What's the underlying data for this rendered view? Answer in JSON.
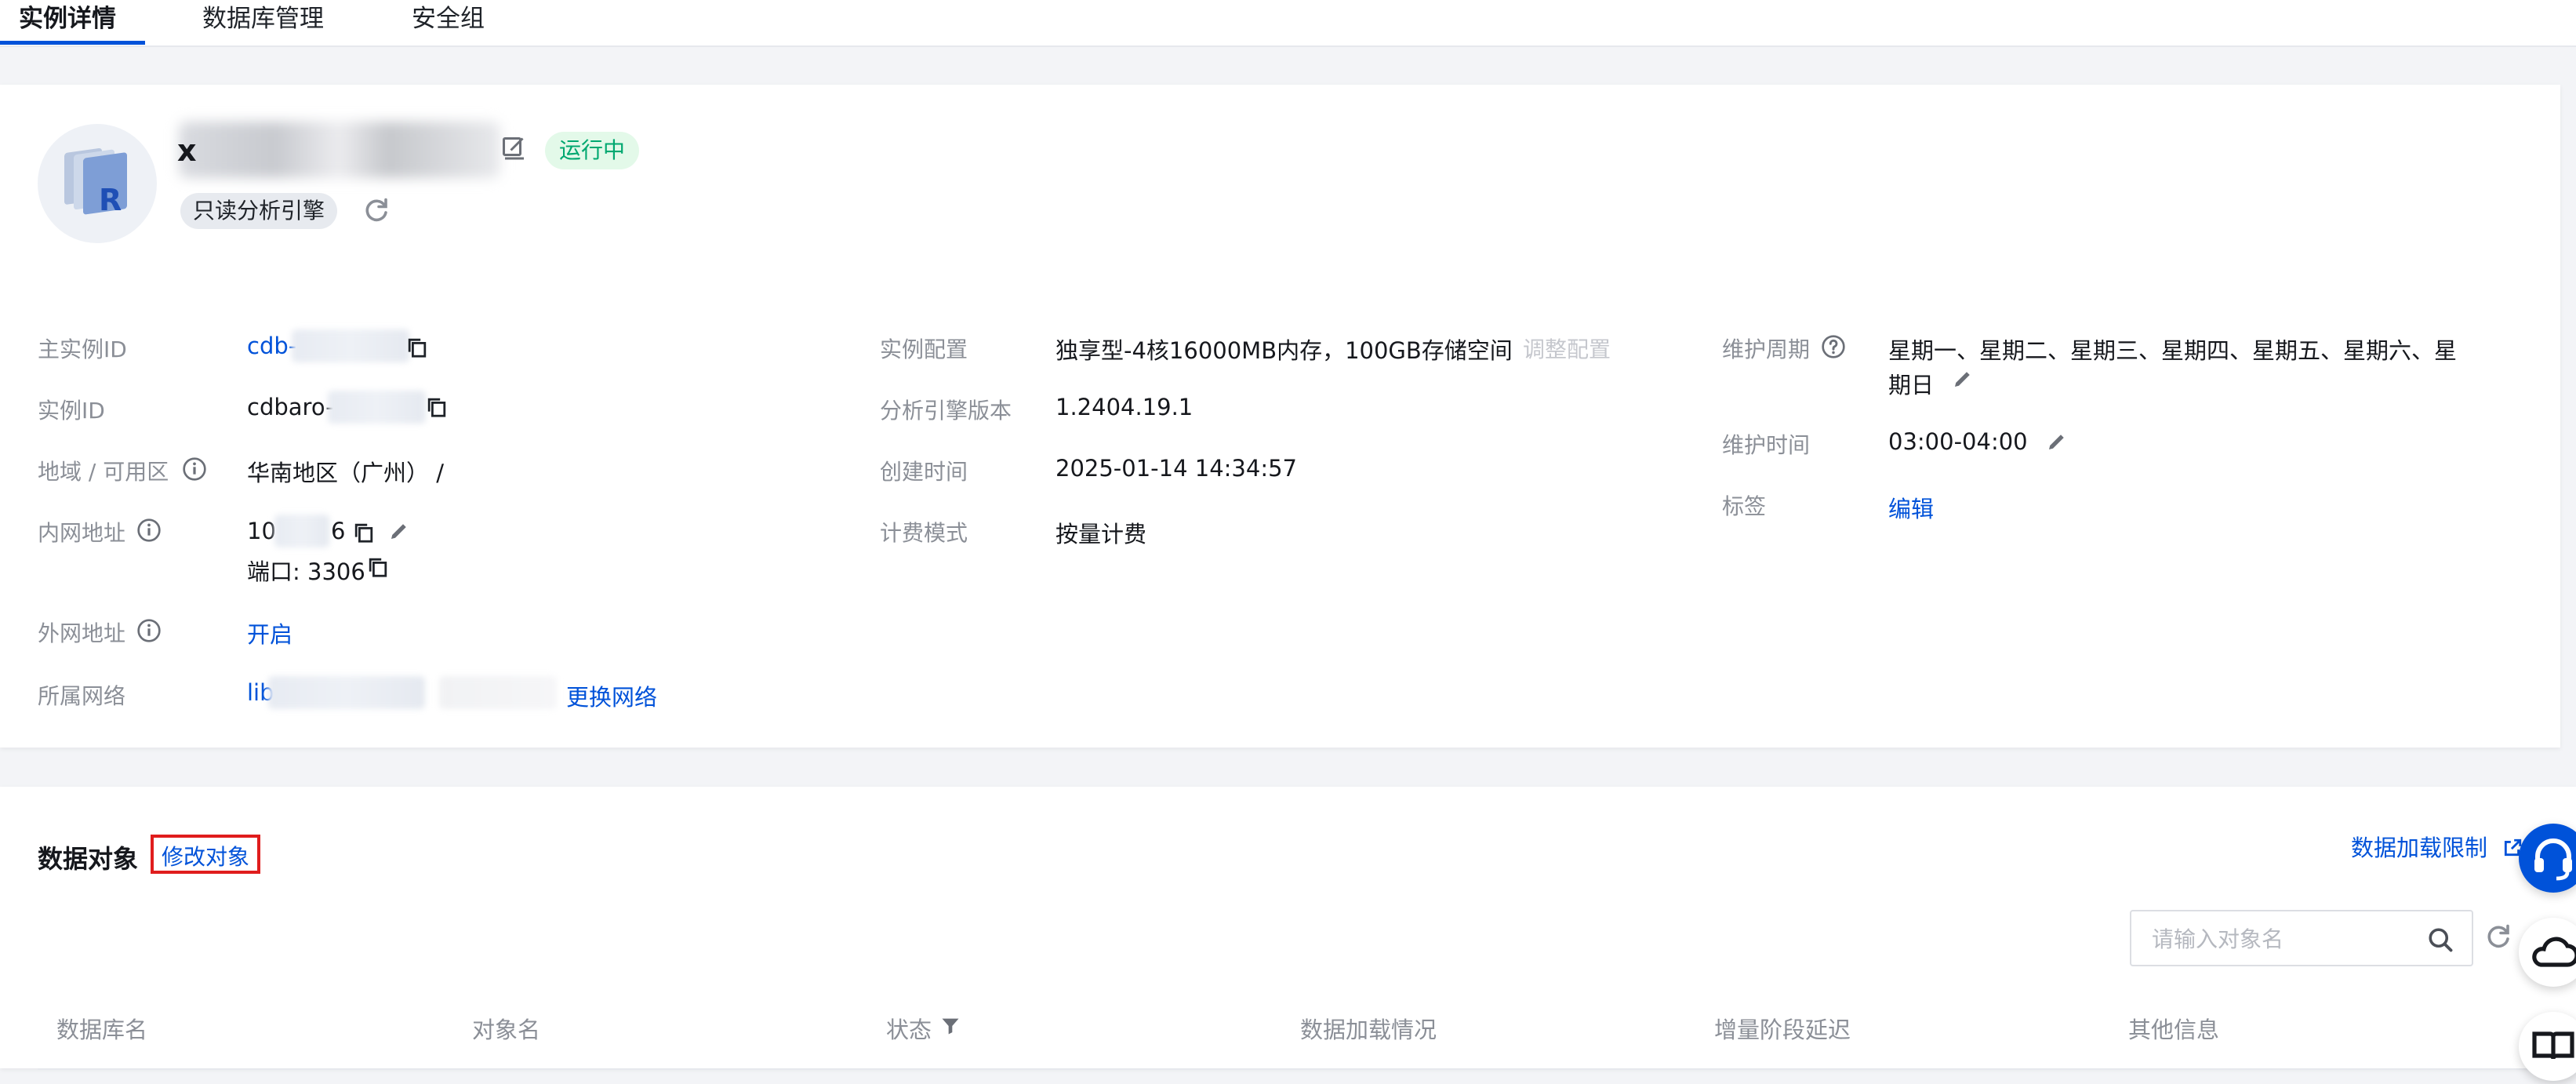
{
  "tabs": [
    {
      "label": "实例详情",
      "active": true
    },
    {
      "label": "数据库管理",
      "active": false
    },
    {
      "label": "安全组",
      "active": false
    }
  ],
  "instance": {
    "name_visible": "x",
    "status": "运行中",
    "engine_badge": "只读分析引擎"
  },
  "col1": {
    "primary_id_label": "主实例ID",
    "primary_id_value": "cdb-",
    "instance_id_label": "实例ID",
    "instance_id_value": "cdbaro-",
    "region_label": "地域 / 可用区",
    "region_value": "华南地区（广州） /",
    "private_addr_label": "内网地址",
    "private_addr_prefix": "10",
    "private_addr_suffix": "6",
    "port_value": "端口: 3306",
    "public_addr_label": "外网地址",
    "public_addr_action": "开启",
    "network_label": "所属网络",
    "network_value": "lib",
    "network_action": "更换网络"
  },
  "col2": {
    "config_label": "实例配置",
    "config_value": "独享型-4核16000MB内存，100GB存储空间",
    "config_action": "调整配置",
    "engine_version_label": "分析引擎版本",
    "engine_version_value": "1.2404.19.1",
    "created_label": "创建时间",
    "created_value": "2025-01-14 14:34:57",
    "billing_label": "计费模式",
    "billing_value": "按量计费"
  },
  "col3": {
    "maint_cycle_label": "维护周期",
    "maint_cycle_line1": "星期一、星期二、星期三、星期四、星期五、星期六、星",
    "maint_cycle_line2": "期日",
    "maint_time_label": "维护时间",
    "maint_time_value": "03:00-04:00",
    "tags_label": "标签",
    "tags_action": "编辑"
  },
  "data_objects": {
    "title": "数据对象",
    "modify_action": "修改对象",
    "load_limit_link": "数据加载限制",
    "search_placeholder": "请输入对象名",
    "columns": [
      "数据库名",
      "对象名",
      "状态",
      "数据加载情况",
      "增量阶段延迟",
      "其他信息"
    ]
  },
  "colors": {
    "accent": "#0052d9",
    "running": "#00a870",
    "highlight_border": "#e01d1d"
  }
}
